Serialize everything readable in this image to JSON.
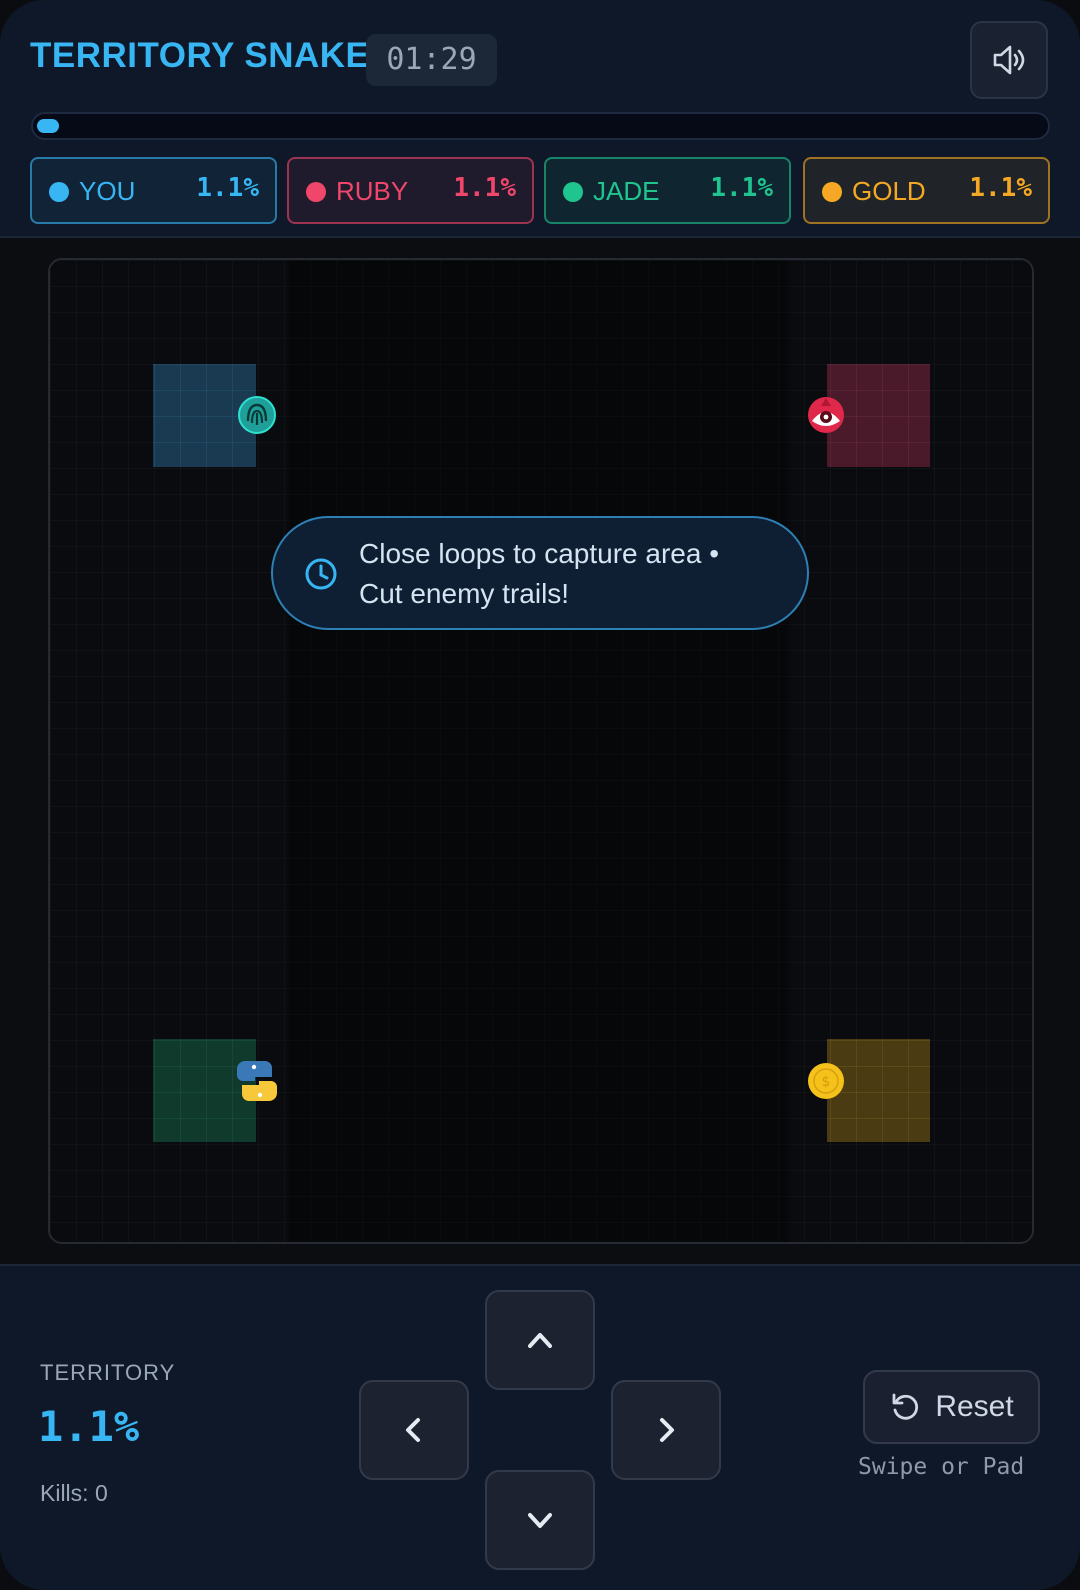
{
  "header": {
    "title": "TERRITORY SNAKE",
    "timer": "01:29",
    "sound_icon": "speaker-volume-icon",
    "progress_fraction": 0.02,
    "accent": "#38b6f4"
  },
  "scores": [
    {
      "name": "YOU",
      "pct": "1.1%",
      "color": "#38b6f4"
    },
    {
      "name": "RUBY",
      "pct": "1.1%",
      "color": "#f0466a"
    },
    {
      "name": "JADE",
      "pct": "1.1%",
      "color": "#1fc48f"
    },
    {
      "name": "GOLD",
      "pct": "1.1%",
      "color": "#f5a823"
    }
  ],
  "arena": {
    "tip_icon": "clock-icon",
    "tip_text_line1": "Close loops to capture area •",
    "tip_text_line2": "Cut enemy trails!",
    "players": [
      {
        "name": "YOU",
        "icon": "fingerprint-icon",
        "color": "#38b6f4"
      },
      {
        "name": "RUBY",
        "icon": "eye-icon",
        "color": "#f0466a"
      },
      {
        "name": "JADE",
        "icon": "python-icon",
        "color": "#1fc48f"
      },
      {
        "name": "GOLD",
        "icon": "coin-icon",
        "color": "#f5a823"
      }
    ]
  },
  "controls": {
    "territory_label": "TERRITORY",
    "territory_value": "1.1%",
    "kills": "Kills: 0",
    "reset_label": "Reset",
    "hint": "Swipe or Pad",
    "pad": [
      "up",
      "left",
      "right",
      "down"
    ]
  }
}
